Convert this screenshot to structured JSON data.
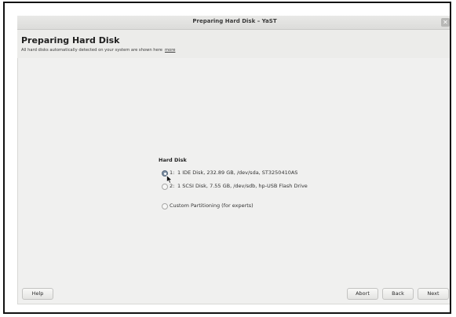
{
  "window": {
    "title": "Preparing Hard Disk – YaST",
    "close_icon": "close-icon"
  },
  "header": {
    "title": "Preparing Hard Disk",
    "subtitle": "All hard disks automatically detected on your system are shown here",
    "more_link": "more"
  },
  "hard_disk": {
    "section_label": "Hard Disk",
    "options": [
      {
        "num": "1:",
        "label": "1 IDE Disk, 232.89 GB, /dev/sda, ST3250410AS",
        "selected": true
      },
      {
        "num": "2:",
        "label": "1 SCSI Disk, 7.55 GB, /dev/sdb, hp-USB Flash Drive",
        "selected": false
      },
      {
        "num": "",
        "label": "Custom Partitioning (for experts)",
        "selected": false
      }
    ]
  },
  "footer": {
    "help": "Help",
    "abort": "Abort",
    "back": "Back",
    "next": "Next"
  },
  "colors": {
    "background": "#f0f0ef",
    "radio_selected": "#7c8ea2"
  }
}
